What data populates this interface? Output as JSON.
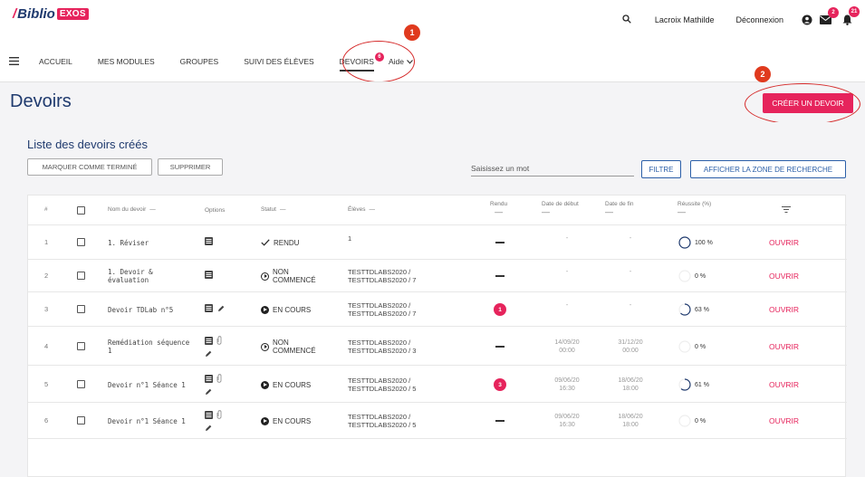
{
  "header": {
    "logo_biblio": "Biblio",
    "logo_exos": "EXOS",
    "user_name": "Lacroix Mathilde",
    "logout_label": "Déconnexion",
    "messages_badge": "2",
    "notifications_badge": "21"
  },
  "nav": {
    "items": [
      "Accueil",
      "Mes modules",
      "Groupes",
      "Suivi des élèves",
      "Devoirs"
    ],
    "devoirs_badge": "6",
    "aide_label": "Aide"
  },
  "annotations": [
    "1",
    "2"
  ],
  "page": {
    "title": "Devoirs",
    "create_button": "Créer un devoir"
  },
  "list": {
    "title": "Liste des devoirs créés",
    "mark_done_button": "Marquer comme terminé",
    "delete_button": "Supprimer",
    "search_placeholder": "Saisissez un mot",
    "filter_button": "Filtre",
    "show_search_button": "Afficher la zone de recherche"
  },
  "table": {
    "headers": {
      "index": "#",
      "name": "Nom du devoir",
      "options": "Options",
      "status": "Statut",
      "students": "Élèves",
      "submitted": "Rendu",
      "start_date": "Date de début",
      "end_date": "Date de fin",
      "success": "Réussite (%)"
    },
    "rows": [
      {
        "index": "1",
        "name": "1. Réviser",
        "status": "RENDU",
        "students_1": "1",
        "students_2": "",
        "submitted": "",
        "start": "-",
        "start_2": "",
        "end": "-",
        "end_2": "",
        "success": "100 %",
        "success_value": 1.0,
        "action": "Ouvrir"
      },
      {
        "index": "2",
        "name": "1. Devoir & évaluation",
        "status": "NON COMMENCÉ",
        "students_1": "TESTTDLABS2020 /",
        "students_2": "TESTTDLABS2020 / 7",
        "submitted": "",
        "start": "-",
        "start_2": "",
        "end": "-",
        "end_2": "",
        "success": "0 %",
        "success_value": 0,
        "action": "Ouvrir"
      },
      {
        "index": "3",
        "name": "Devoir TDLab n°5",
        "status": "EN COURS",
        "students_1": "TESTTDLABS2020 /",
        "students_2": "TESTTDLABS2020 / 7",
        "submitted": "1",
        "start": "-",
        "start_2": "",
        "end": "-",
        "end_2": "",
        "success": "63 %",
        "success_value": 0.63,
        "action": "Ouvrir"
      },
      {
        "index": "4",
        "name": "Remédiation séquence 1",
        "status": "NON COMMENCÉ",
        "students_1": "TESTTDLABS2020 /",
        "students_2": "TESTTDLABS2020 / 3",
        "submitted": "",
        "start": "14/09/20",
        "start_2": "00:00",
        "end": "31/12/20",
        "end_2": "00:00",
        "success": "0 %",
        "success_value": 0,
        "action": "Ouvrir"
      },
      {
        "index": "5",
        "name": "Devoir n°1 Séance 1",
        "status": "EN COURS",
        "students_1": "TESTTDLABS2020 /",
        "students_2": "TESTTDLABS2020 / 5",
        "submitted": "3",
        "start": "09/06/20",
        "start_2": "16:30",
        "end": "18/06/20",
        "end_2": "18:00",
        "success": "61 %",
        "success_value": 0.61,
        "action": "Ouvrir"
      },
      {
        "index": "6",
        "name": "Devoir n°1 Séance 1",
        "status": "EN COURS",
        "students_1": "TESTTDLABS2020 /",
        "students_2": "TESTTDLABS2020 / 5",
        "submitted": "",
        "start": "09/06/20",
        "start_2": "16:30",
        "end": "18/06/20",
        "end_2": "18:00",
        "success": "0 %",
        "success_value": 0,
        "action": "Ouvrir"
      }
    ]
  },
  "colors": {
    "accent": "#e6245c",
    "brand": "#1f3a6e",
    "annotation": "#d52a2a"
  }
}
